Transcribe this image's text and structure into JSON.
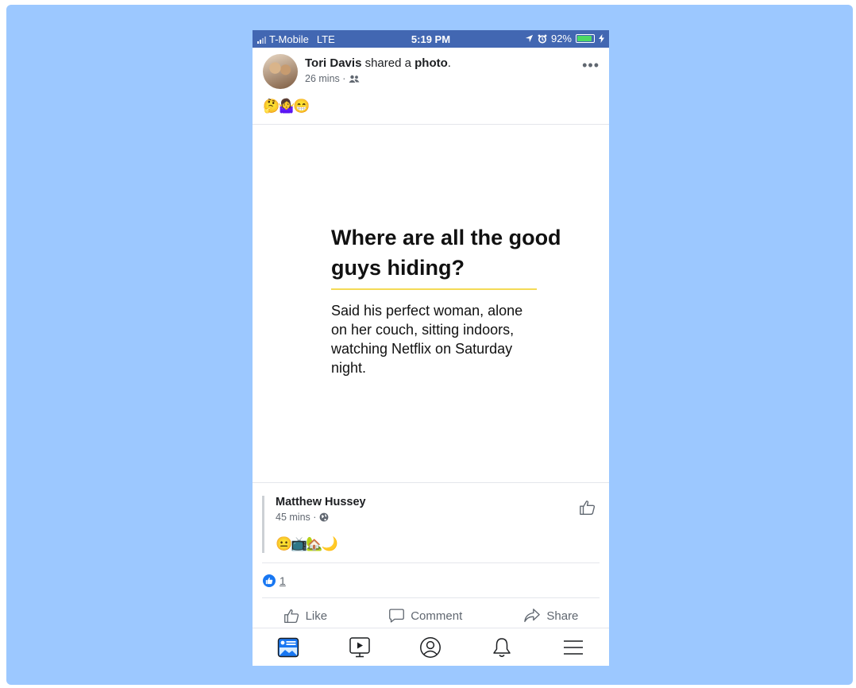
{
  "status_bar": {
    "carrier": "T-Mobile",
    "network": "LTE",
    "time": "5:19 PM",
    "battery": "92%",
    "battery_level": 0.92
  },
  "post": {
    "author": "Tori Davis",
    "action_prefix": "shared a",
    "action_object": "photo",
    "action_suffix": ".",
    "time": "26 mins ·",
    "audience_icon": "friends-icon",
    "more": "•••",
    "emojis": "🤔🤷‍♀️😁"
  },
  "photo": {
    "title": "Where are all the good guys hiding?",
    "body": "Said his perfect woman, alone on her couch, sitting indoors, watching Netflix on Saturday night.",
    "underline_color": "#f4da56"
  },
  "shared_post": {
    "author": "Matthew Hussey",
    "time": "45 mins ·",
    "audience_icon": "globe-icon",
    "emojis": "😐📺🏡🌙"
  },
  "reactions": {
    "count": "1"
  },
  "actions": {
    "like": "Like",
    "comment": "Comment",
    "share": "Share"
  },
  "tabbar": {
    "items": [
      "news-feed-icon",
      "watch-icon",
      "profile-icon",
      "notifications-icon",
      "menu-icon"
    ]
  },
  "colors": {
    "background": "#9cc8ff",
    "header": "#4267b2",
    "accent": "#1877f2"
  }
}
